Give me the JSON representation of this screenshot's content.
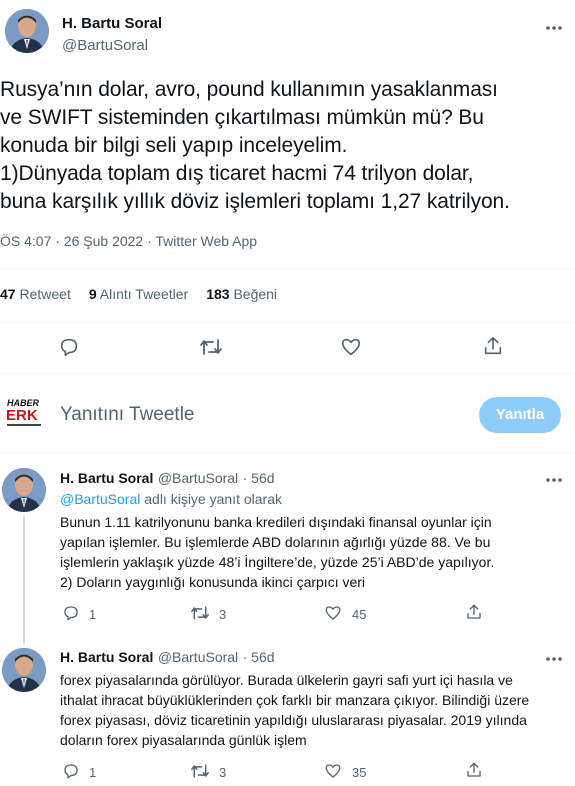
{
  "main_tweet": {
    "author_name": "H. Bartu Soral",
    "author_handle": "@BartuSoral",
    "text": "Rusya’nın dolar, avro, pound kullanımın yasaklanması\nve SWIFT sisteminden çıkartılması mümkün mü? Bu\nkonuda bir bilgi seli yapıp inceleyelim.\n1)Dünyada toplam dış ticaret hacmi 74 trilyon dolar,\nbuna karşılık yıllık döviz işlemleri toplamı 1,27 katrilyon.",
    "meta": "ÖS 4:07 · 26 Şub 2022 · Twitter Web App",
    "retweets_count": "47",
    "retweets_label": "Retweet",
    "quotes_count": "9",
    "quotes_label": "Alıntı Tweetler",
    "likes_count": "183",
    "likes_label": "Beğeni"
  },
  "reply_box": {
    "logo_line1": "HABER",
    "logo_line2": "ERK",
    "placeholder": "Yanıtını Tweetle",
    "button_label": "Yanıtla"
  },
  "replies": [
    {
      "author_name": "H. Bartu Soral",
      "author_handle": "@BartuSoral",
      "time": "· 56d",
      "replying_to_handle": "@BartuSoral",
      "replying_to_suffix": "adlı kişiye yanıt olarak",
      "text": "Bunun 1.11 katrilyonunu banka kredileri dışındaki finansal oyunlar için\nyapılan işlemler. Bu işlemlerde ABD dolarının ağırlığı yüzde 88. Ve bu\nişlemlerin yaklaşık yüzde 48’i İngiltere’de, yüzde 25’i ABD’de yapılıyor.\n2) Doların yaygınlığı konusunda ikinci çarpıcı veri",
      "reply_count": "1",
      "retweet_count": "3",
      "like_count": "45"
    },
    {
      "author_name": "H. Bartu Soral",
      "author_handle": "@BartuSoral",
      "time": "· 56d",
      "text": "forex piyasalarında görülüyor. Burada ülkelerin gayri safi yurt içi hasıla ve\nithalat ihracat büyüklüklerinden çok farklı bir manzara çıkıyor. Bilindiği üzere\nforex piyasası, döviz ticaretinin yapıldığı uluslararası piyasalar. 2019 yılında\ndoların forex piyasalarında günlük işlem",
      "reply_count": "1",
      "retweet_count": "3",
      "like_count": "35"
    }
  ],
  "colors": {
    "accent": "#1d9bf0",
    "button_disabled": "#8ecdf8",
    "muted_text": "#536471",
    "divider": "#eff3f4"
  },
  "icons": [
    "reply-icon",
    "retweet-icon",
    "like-icon",
    "share-icon",
    "more-icon"
  ]
}
